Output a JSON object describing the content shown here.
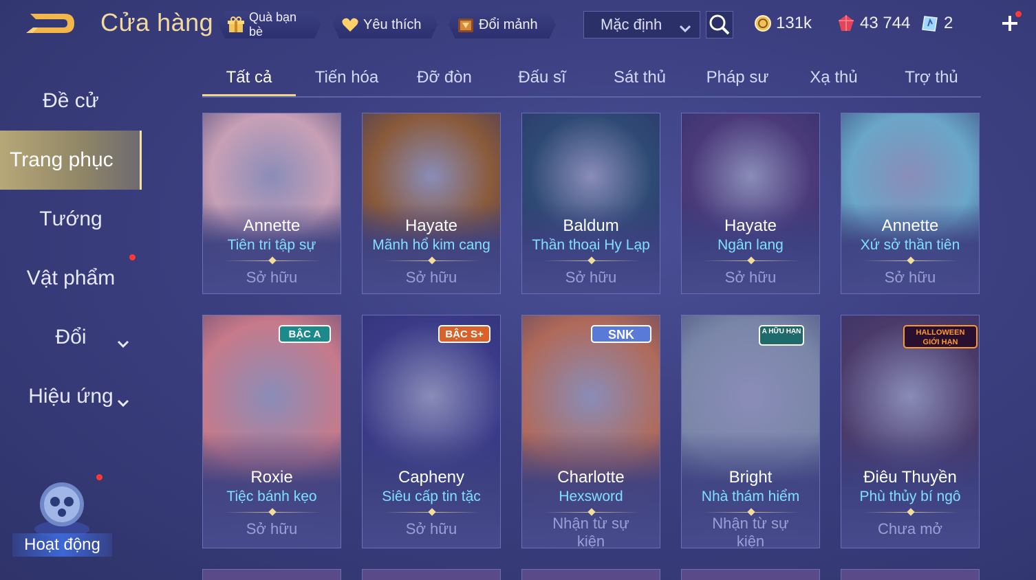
{
  "header": {
    "title": "Cửa hàng",
    "friend_gift": "Quà bạn bè",
    "favorites": "Yêu thích",
    "exchange_shards": "Đổi mảnh",
    "sort_value": "Mặc định",
    "gold": "131k",
    "coupons": "43 744",
    "tokens": "2"
  },
  "sidebar": {
    "items": [
      {
        "label": "Đề cử"
      },
      {
        "label": "Trang phục"
      },
      {
        "label": "Tướng"
      },
      {
        "label": "Vật phẩm"
      },
      {
        "label": "Đổi"
      },
      {
        "label": "Hiệu ứng"
      }
    ],
    "activity_label": "Hoạt động"
  },
  "tabs": [
    {
      "label": "Tất cả"
    },
    {
      "label": "Tiến hóa"
    },
    {
      "label": "Đỡ đòn"
    },
    {
      "label": "Đấu sĩ"
    },
    {
      "label": "Sát thủ"
    },
    {
      "label": "Pháp sư"
    },
    {
      "label": "Xạ thủ"
    },
    {
      "label": "Trợ thủ"
    }
  ],
  "cards": [
    {
      "hero": "Annette",
      "skin": "Tiên tri tập sự",
      "status": "Sở hữu",
      "badge": "",
      "color": "#c8a0b6"
    },
    {
      "hero": "Hayate",
      "skin": "Mãnh hổ kim cang",
      "status": "Sở hữu",
      "badge": "",
      "color": "#8a5a3a"
    },
    {
      "hero": "Baldum",
      "skin": "Thần thoại Hy Lạp",
      "status": "Sở hữu",
      "badge": "",
      "color": "#2e4a74"
    },
    {
      "hero": "Hayate",
      "skin": "Ngân lang",
      "status": "Sở hữu",
      "badge": "",
      "color": "#4b3a7a"
    },
    {
      "hero": "Annette",
      "skin": "Xứ sở thần tiên",
      "status": "Sở hữu",
      "badge": "",
      "color": "#6aa6c8"
    },
    {
      "hero": "Roxie",
      "skin": "Tiệc bánh kẹo",
      "status": "Sở hữu",
      "badge": "BẬC A",
      "color": "#c77a8a"
    },
    {
      "hero": "Capheny",
      "skin": "Siêu cấp tin tặc",
      "status": "Sở hữu",
      "badge": "BẬC S+",
      "color": "#3a3a88"
    },
    {
      "hero": "Charlotte",
      "skin": "Hexsword",
      "status": "Nhận từ sự kiện",
      "badge": "SNK",
      "color": "#b06a5a"
    },
    {
      "hero": "Bright",
      "skin": "Nhà thám hiểm",
      "status": "Nhận từ sự kiện",
      "badge": "A HỮU HẠN",
      "color": "#7a86a8"
    },
    {
      "hero": "Điêu Thuyền",
      "skin": "Phù thủy bí ngô",
      "status": "Chưa mở",
      "badge": "HALLOWEEN GIỚI HẠN",
      "color": "#4a3a6a"
    }
  ]
}
